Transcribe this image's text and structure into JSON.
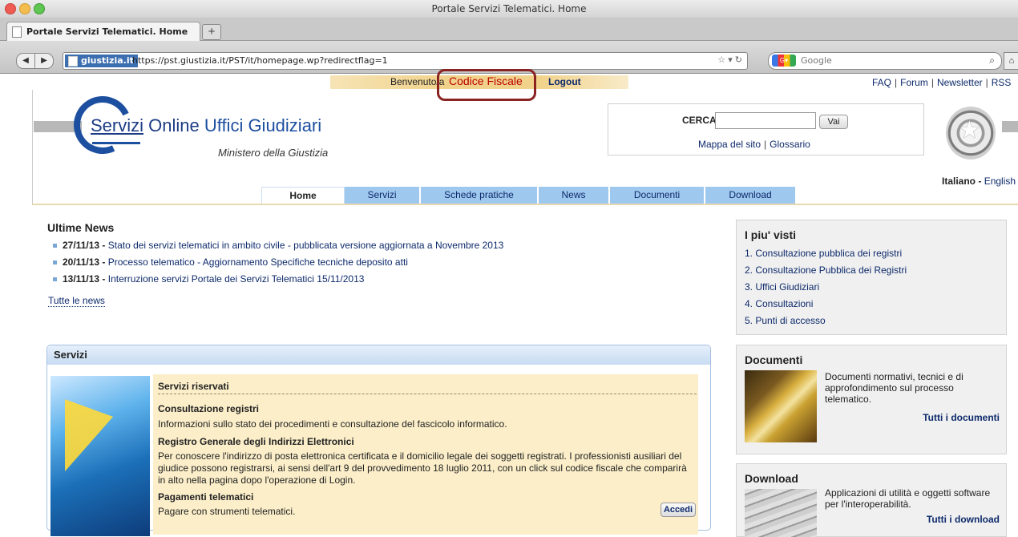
{
  "window": {
    "title": "Portale Servizi Telematici. Home"
  },
  "tab": {
    "label": "Portale Servizi Telematici. Home",
    "new_tab": "+"
  },
  "nav": {
    "site_badge": "giustizia.it",
    "url": "https://pst.giustizia.it/PST/it/homepage.wp?redirectflag=1",
    "search_placeholder": "Google"
  },
  "login": {
    "welcome": "Benvenuto/a",
    "user": "Codice Fiscale",
    "logout": "Logout"
  },
  "toplinks": [
    "FAQ",
    "Forum",
    "Newsletter",
    "RSS"
  ],
  "logo": {
    "title_a": "Servizi",
    "title_b": " Online ",
    "title_c": "Uffici Giudiziari",
    "subtitle": "Ministero della Giustizia"
  },
  "search": {
    "label": "CERCA",
    "button": "Vai",
    "link1": "Mappa del sito",
    "link2": "Glossario"
  },
  "language": {
    "it": "Italiano",
    "sep": " - ",
    "en": "English"
  },
  "tabs": [
    "Home",
    "Servizi",
    "Schede pratiche",
    "News",
    "Documenti",
    "Download"
  ],
  "news": {
    "title": "Ultime News",
    "items": [
      {
        "date": "27/11/13 -",
        "text": "Stato dei servizi telematici in ambito civile - pubblicata versione aggiornata a Novembre 2013"
      },
      {
        "date": "20/11/13 -",
        "text": "Processo telematico - Aggiornamento Specifiche tecniche deposito atti"
      },
      {
        "date": "13/11/13 -",
        "text": "Interruzione servizi Portale dei Servizi Telematici 15/11/2013"
      }
    ],
    "all": "Tutte le news"
  },
  "servizi": {
    "title": "Servizi",
    "section": "Servizi riservati",
    "h1": "Consultazione registri",
    "t1": "Informazioni sullo stato dei procedimenti e consultazione del fascicolo informatico.",
    "h2": "Registro Generale degli Indirizzi Elettronici",
    "t2": "Per conoscere l'indirizzo di posta elettronica certificata e il domicilio legale dei soggetti registrati. I professionisti ausiliari del giudice possono registrarsi, ai sensi dell'art 9 del provvedimento 18 luglio 2011, con un click sul codice fiscale che comparirà in alto nella pagina dopo l'operazione di Login.",
    "h3": "Pagamenti telematici",
    "t3": "Pagare con strumenti telematici.",
    "button": "Accedi"
  },
  "piu_visti": {
    "title": "I piu' visti",
    "items": [
      "1. Consultazione pubblica dei registri",
      "2. Consultazione Pubblica dei Registri",
      "3. Uffici Giudiziari",
      "4. Consultazioni",
      "5. Punti di accesso"
    ]
  },
  "documenti": {
    "title": "Documenti",
    "text": "Documenti normativi, tecnici e di approfondimento sul processo telematico.",
    "link": "Tutti i documenti"
  },
  "download": {
    "title": "Download",
    "text": "Applicazioni di utilità e oggetti software per l'interoperabilità.",
    "link": "Tutti i download"
  }
}
